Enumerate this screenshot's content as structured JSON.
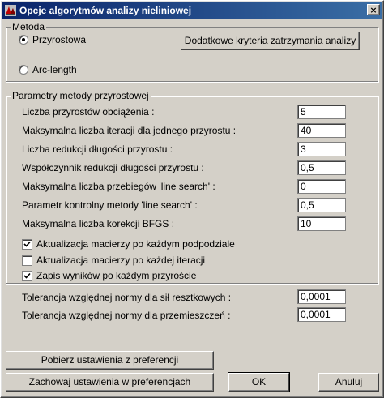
{
  "window": {
    "title": "Opcje algorytmów analizy nieliniowej",
    "close_label": "×"
  },
  "metoda": {
    "legend": "Metoda",
    "options": [
      {
        "label": "Przyrostowa",
        "checked": true
      },
      {
        "label": "Arc-length",
        "checked": false
      }
    ],
    "criteria_button": "Dodatkowe kryteria zatrzymania analizy"
  },
  "params": {
    "legend": "Parametry metody przyrostowej",
    "rows": [
      {
        "label": "Liczba przyrostów obciążenia :",
        "value": "5"
      },
      {
        "label": "Maksymalna liczba iteracji dla jednego przyrostu :",
        "value": "40"
      },
      {
        "label": "Liczba redukcji długości przyrostu :",
        "value": "3"
      },
      {
        "label": "Współczynnik redukcji długości przyrostu :",
        "value": "0,5"
      },
      {
        "label": "Maksymalna liczba przebiegów 'line search' :",
        "value": "0"
      },
      {
        "label": "Parametr kontrolny metody 'line search' :",
        "value": "0,5"
      },
      {
        "label": "Maksymalna liczba korekcji BFGS :",
        "value": "10"
      }
    ],
    "checkboxes": [
      {
        "label": "Aktualizacja macierzy po każdym podpodziale",
        "checked": true
      },
      {
        "label": "Aktualizacja macierzy po każdej iteracji",
        "checked": false
      },
      {
        "label": "Zapis wyników  po każdym przyroście",
        "checked": true
      }
    ]
  },
  "tolerances": [
    {
      "label": "Tolerancja względnej normy dla sił resztkowych :",
      "value": "0,0001"
    },
    {
      "label": "Tolerancja względnej normy dla przemieszczeń :",
      "value": "0,0001"
    }
  ],
  "buttons": {
    "load_prefs": "Pobierz ustawienia z preferencji",
    "save_prefs": "Zachowaj ustawienia w preferencjach",
    "ok": "OK",
    "cancel": "Anuluj"
  }
}
